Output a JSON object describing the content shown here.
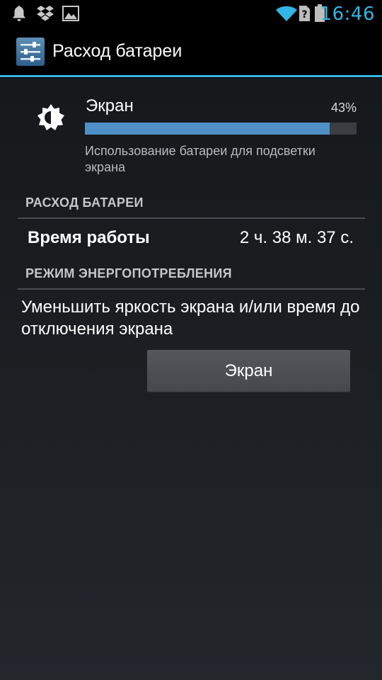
{
  "status_bar": {
    "time": "16:46",
    "icons": [
      "bell-icon",
      "dropbox-icon",
      "image-icon",
      "wifi-icon",
      "no-sim-icon",
      "battery-icon"
    ],
    "accent_color": "#33b5e5"
  },
  "action_bar": {
    "title": "Расход батареи",
    "icon": "settings-sliders-icon"
  },
  "app_usage": {
    "icon": "brightness-icon",
    "name": "Экран",
    "percent_label": "43%",
    "percent_value": 43,
    "description": "Использование батареи для подсветки экрана",
    "bar_color": "#4f90c6"
  },
  "battery_section": {
    "header": "РАСХОД БАТАРЕИ",
    "rows": [
      {
        "label": "Время работы",
        "value": "2 ч. 38 м. 37 с."
      }
    ]
  },
  "power_section": {
    "header": "РЕЖИМ ЭНЕРГОПОТРЕБЛЕНИЯ",
    "advice": "Уменьшить яркость экрана и/или время до отключения экрана",
    "button_label": "Экран"
  }
}
